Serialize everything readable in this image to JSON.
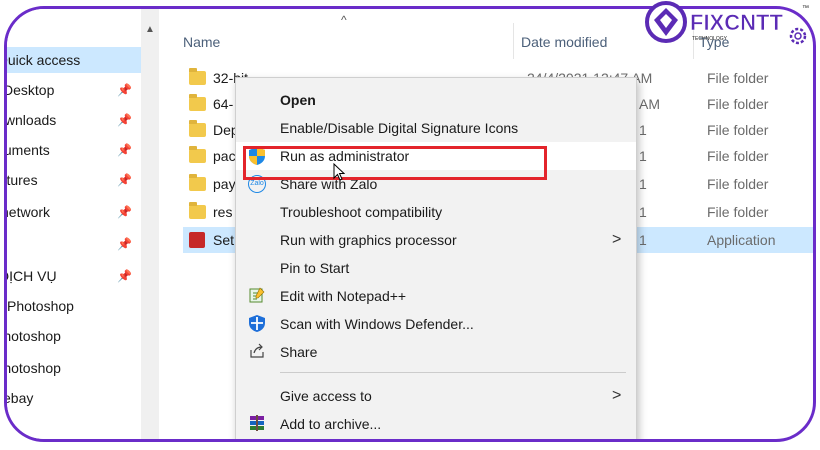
{
  "nav": {
    "items": [
      {
        "label": "Quick access",
        "pinned": false,
        "selected": true
      },
      {
        "label": "Desktop",
        "pinned": true
      },
      {
        "label": "Downloads",
        "pinned": true
      },
      {
        "label": "Documents",
        "pinned": true
      },
      {
        "label": "Pictures",
        "pinned": true
      },
      {
        "label": "network",
        "pinned": true
      },
      {
        "label": "",
        "pinned": true
      },
      {
        "label": "DỊCH VỤ",
        "pinned": true
      },
      {
        "label": "Photoshop",
        "pinned": false
      },
      {
        "label": "Photoshop",
        "pinned": false
      },
      {
        "label": "Photoshop",
        "pinned": false
      },
      {
        "label": "ebay",
        "pinned": false
      }
    ]
  },
  "columns": {
    "name": "Name",
    "date": "Date modified",
    "type": "Type"
  },
  "files": [
    {
      "name": "32-bit",
      "date": "24/4/2021 12:47 AM",
      "type": "File folder",
      "icon": "folder-icon"
    },
    {
      "name": "64-",
      "date": "AM",
      "type": "File folder",
      "icon": "folder-icon"
    },
    {
      "name": "Dep",
      "date": "1",
      "type": "File folder",
      "icon": "folder-icon"
    },
    {
      "name": "pac",
      "date": "1",
      "type": "File folder",
      "icon": "folder-icon"
    },
    {
      "name": "pay",
      "date": "1",
      "type": "File folder",
      "icon": "folder-icon"
    },
    {
      "name": "res",
      "date": "1",
      "type": "File folder",
      "icon": "folder-icon"
    },
    {
      "name": "Set",
      "date": "1",
      "type": "Application",
      "icon": "app-icon",
      "selected": true
    }
  ],
  "context_menu": {
    "items": [
      {
        "label": "Open",
        "bold": true
      },
      {
        "label": "Enable/Disable Digital Signature Icons"
      },
      {
        "label": "Run as administrator",
        "icon": "shield-icon",
        "hover": true
      },
      {
        "label": "Share with Zalo",
        "icon": "zalo-icon"
      },
      {
        "label": "Troubleshoot compatibility"
      },
      {
        "label": "Run with graphics processor",
        "submenu": true
      },
      {
        "label": "Pin to Start"
      },
      {
        "label": "Edit with Notepad++",
        "icon": "notepad-icon"
      },
      {
        "label": "Scan with Windows Defender...",
        "icon": "defender-icon"
      },
      {
        "label": "Share",
        "icon": "share-icon"
      },
      {
        "label": "Give access to",
        "submenu": true
      },
      {
        "label": "Add to archive...",
        "icon": "archive-icon"
      }
    ],
    "zalo_icon_text": "Zalo"
  },
  "logo": {
    "text": "FIXCNTT",
    "subtext": "TECHNOLOGY",
    "tm": "™",
    "color": "#5b2bb5"
  },
  "colors": {
    "accent_frame": "#6a2cc9",
    "highlight": "#e3242b",
    "selection": "#cce8ff"
  }
}
